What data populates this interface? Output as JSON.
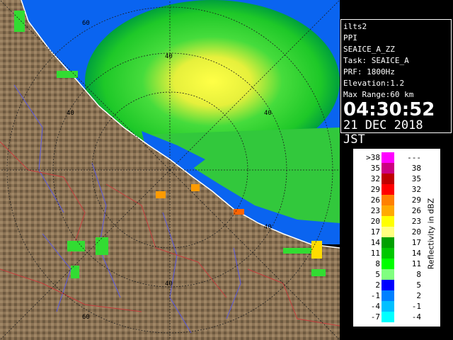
{
  "info": {
    "radar_name": "ilts2",
    "scan_type": "PPI",
    "product": "SEAICE_A_ZZ",
    "task": "Task: SEAICE_A",
    "prf": "PRF: 1800Hz",
    "elevation": "Elevation:1.2",
    "max_range": "Max Range:60 km",
    "time": "04:30:52",
    "date": "21 DEC 2018 JST"
  },
  "range_labels": [
    "60",
    "40",
    "40",
    "40",
    "40",
    "40",
    "60"
  ],
  "legend": {
    "axis_label": "Reflectivity in dBZ",
    "rows": [
      {
        "lo": ">38",
        "hi": "---",
        "color": "#ff00ff"
      },
      {
        "lo": "35",
        "hi": "38",
        "color": "#cc0080"
      },
      {
        "lo": "32",
        "hi": "35",
        "color": "#c00000"
      },
      {
        "lo": "29",
        "hi": "32",
        "color": "#ff0000"
      },
      {
        "lo": "26",
        "hi": "29",
        "color": "#ff8000"
      },
      {
        "lo": "23",
        "hi": "26",
        "color": "#ffaa00"
      },
      {
        "lo": "20",
        "hi": "23",
        "color": "#ffff00"
      },
      {
        "lo": "17",
        "hi": "20",
        "color": "#ffff80"
      },
      {
        "lo": "14",
        "hi": "17",
        "color": "#00a000"
      },
      {
        "lo": "11",
        "hi": "14",
        "color": "#00c800"
      },
      {
        "lo": "8",
        "hi": "11",
        "color": "#00ff00"
      },
      {
        "lo": "5",
        "hi": "8",
        "color": "#80ff80"
      },
      {
        "lo": "2",
        "hi": "5",
        "color": "#0000ff"
      },
      {
        "lo": "-1",
        "hi": "2",
        "color": "#0080ff"
      },
      {
        "lo": "-4",
        "hi": "-1",
        "color": "#00c0ff"
      },
      {
        "lo": "-7",
        "hi": "-4",
        "color": "#00ffff"
      }
    ]
  },
  "colors": {
    "background": "#000000",
    "land": "#8c7355",
    "radar_blue": "#0a64f0",
    "echo_green": "#32e632",
    "echo_yellow": "#ffff32"
  }
}
